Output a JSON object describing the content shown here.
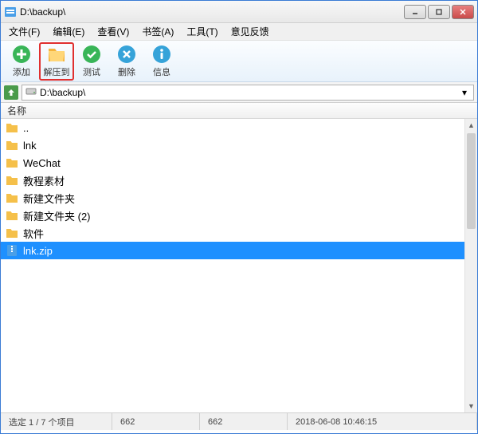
{
  "window": {
    "title": "D:\\backup\\"
  },
  "menu": {
    "items": [
      {
        "label": "文件(F)"
      },
      {
        "label": "编辑(E)"
      },
      {
        "label": "查看(V)"
      },
      {
        "label": "书签(A)"
      },
      {
        "label": "工具(T)"
      },
      {
        "label": "意见反馈"
      }
    ]
  },
  "toolbar": {
    "items": [
      {
        "label": "添加",
        "icon": "add",
        "color": "#38b558"
      },
      {
        "label": "解压到",
        "icon": "extract",
        "color": "#f5b33b",
        "highlighted": true
      },
      {
        "label": "测试",
        "icon": "test",
        "color": "#38b558"
      },
      {
        "label": "删除",
        "icon": "delete",
        "color": "#36a3d9"
      },
      {
        "label": "信息",
        "icon": "info",
        "color": "#36a3d9"
      }
    ]
  },
  "address": {
    "path": "D:\\backup\\"
  },
  "columns": {
    "name": "名称"
  },
  "files": [
    {
      "name": "..",
      "type": "up"
    },
    {
      "name": "lnk",
      "type": "folder"
    },
    {
      "name": "WeChat",
      "type": "folder"
    },
    {
      "name": "教程素材",
      "type": "folder"
    },
    {
      "name": "新建文件夹",
      "type": "folder"
    },
    {
      "name": "新建文件夹 (2)",
      "type": "folder"
    },
    {
      "name": "软件",
      "type": "folder"
    },
    {
      "name": "lnk.zip",
      "type": "zip",
      "selected": true
    }
  ],
  "status": {
    "selection": "选定 1 / 7 个项目",
    "size1": "662",
    "size2": "662",
    "datetime": "2018-06-08 10:46:15"
  }
}
